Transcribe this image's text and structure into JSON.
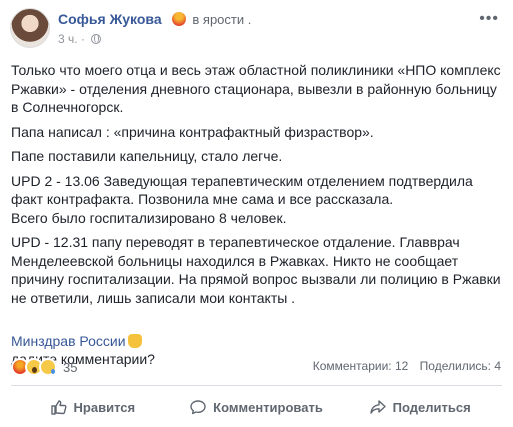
{
  "post": {
    "author": "Софья Жукова",
    "feeling": "в ярости .",
    "time": "3 ч. ·",
    "more_label": "•••",
    "paragraphs": [
      "Только что моего отца и весь этаж областной поликлиники «НПО комплекс Ржавки» - отделения дневного стационара, вывезли в районную больницу в Солнечногорск.",
      "Папа написал : «причина контрафактный физраствор».",
      "Папе поставили капельницу, стало легче.",
      "UPD 2 - 13.06 Заведующая терапевтическим отделением подтвердила факт контрафакта. Позвонила мне сама и все рассказала.\nВсего было госпитализировано 8 человек.",
      "UPD - 12.31 папу переводят в терапевтическое отдаление. Главврач Менделеевской больницы находился в Ржавках. Никто не сообщает причину госпитализации. На прямой вопрос вызвали ли полицию в Ржавки не ответили, лишь записали мои контакты ."
    ],
    "mention": "Минздрав России",
    "mention_suffix": "дадите комментарии?"
  },
  "reactions": {
    "icons": [
      "angry-icon",
      "wow-icon",
      "sad-icon"
    ],
    "count": "35",
    "comments": "Комментарии: 12",
    "shares": "Поделились: 4"
  },
  "actions": {
    "like": "Нравится",
    "comment": "Комментировать",
    "share": "Поделиться"
  },
  "colors": {
    "link": "#385898",
    "text": "#1d2129",
    "muted": "#606770",
    "divider": "#dadde1"
  }
}
